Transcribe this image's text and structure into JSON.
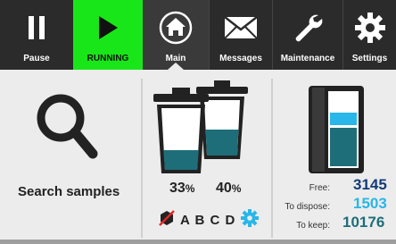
{
  "tabs": [
    {
      "label": "Pause",
      "icon": "pause-icon"
    },
    {
      "label": "RUNNING",
      "icon": "play-icon"
    },
    {
      "label": "Main",
      "icon": "home-icon"
    },
    {
      "label": "Messages",
      "icon": "envelope-icon"
    },
    {
      "label": "Maintenance",
      "icon": "wrench-icon"
    },
    {
      "label": "Settings",
      "icon": "gear-icon"
    }
  ],
  "search": {
    "label": "Search samples",
    "icon": "search-icon"
  },
  "waste": {
    "bin1_percent": "33",
    "bin2_percent": "40",
    "percent_sign": "%",
    "tags": "A B C D"
  },
  "storage": {
    "free_label": "Free:",
    "free_value": "3145",
    "dispose_label": "To dispose:",
    "dispose_value": "1503",
    "keep_label": "To keep:",
    "keep_value": "10176"
  },
  "colors": {
    "topbar": "#2b2b2b",
    "running": "#19e619",
    "teal": "#1e6e7a",
    "light_blue": "#29b6e8",
    "dark_blue": "#123a78"
  }
}
